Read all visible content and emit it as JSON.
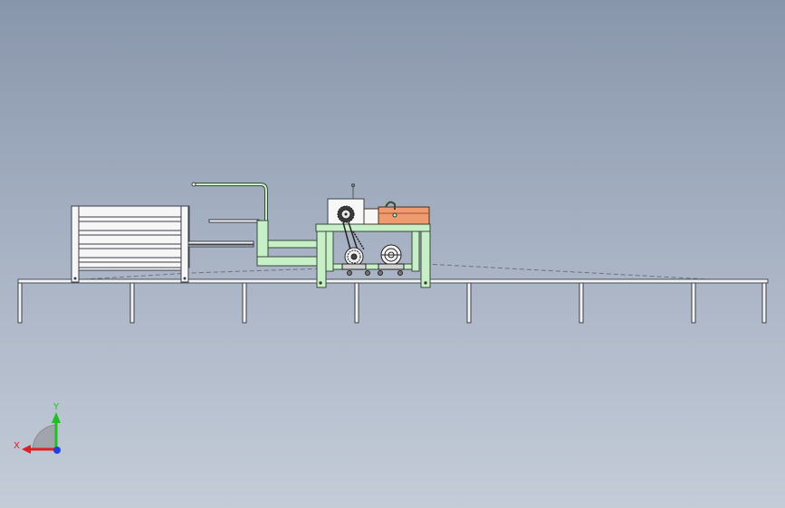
{
  "viewport": {
    "background_top": "#8896ab",
    "background_bottom": "#c4ccd8",
    "view_orientation": "front"
  },
  "model": {
    "parts": [
      "rail-track",
      "rail-support-legs",
      "storage-rack",
      "feed-arm",
      "pipe-loop",
      "main-frame",
      "motor-housing",
      "gear-wheel",
      "heater-block",
      "drive-pulley",
      "spool-wheel",
      "chain-drive"
    ],
    "colors": {
      "frame_green": "#c8f0c8",
      "frame_outline": "#3a4a3a",
      "heater_orange": "#f09a70",
      "rail_white": "#f4f4f4",
      "motor_white": "#f7f7f7"
    }
  },
  "triad": {
    "x_label": "X",
    "y_label": "Y",
    "x_color": "#e02020",
    "y_color": "#20c020",
    "z_color": "#2040e0"
  }
}
